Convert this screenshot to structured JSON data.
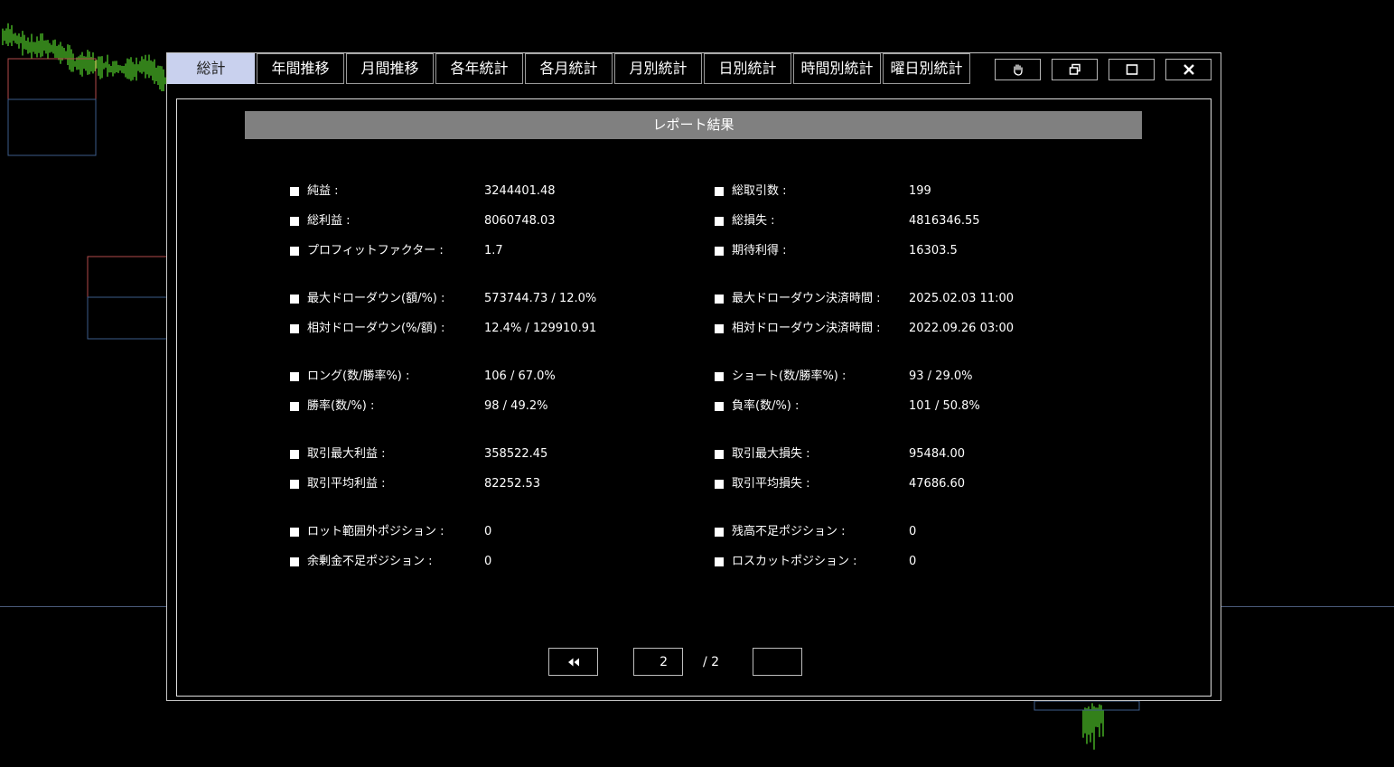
{
  "tabs": [
    "総計",
    "年間推移",
    "月間推移",
    "各年統計",
    "各月統計",
    "月別統計",
    "日別統計",
    "時間別統計",
    "曜日別統計"
  ],
  "window_buttons": [
    {
      "name": "hand-icon"
    },
    {
      "name": "restore-icon"
    },
    {
      "name": "maximize-icon"
    },
    {
      "name": "close-icon"
    }
  ],
  "report": {
    "title": "レポート結果",
    "left": [
      {
        "label": "純益 :",
        "value": "3244401.48"
      },
      {
        "label": "総利益 :",
        "value": "8060748.03"
      },
      {
        "label": "プロフィットファクター :",
        "value": "1.7"
      },
      {
        "label": "最大ドローダウン(額/%) :",
        "value": "573744.73 / 12.0%"
      },
      {
        "label": "相対ドローダウン(%/額) :",
        "value": "12.4% / 129910.91"
      },
      {
        "label": "ロング(数/勝率%) :",
        "value": "106 / 67.0%"
      },
      {
        "label": "勝率(数/%) :",
        "value": "98 / 49.2%"
      },
      {
        "label": "取引最大利益 :",
        "value": "358522.45"
      },
      {
        "label": "取引平均利益 :",
        "value": "82252.53"
      },
      {
        "label": "ロット範囲外ポジション :",
        "value": "0"
      },
      {
        "label": "余剰金不足ポジション :",
        "value": "0"
      }
    ],
    "right": [
      {
        "label": "総取引数 :",
        "value": "199"
      },
      {
        "label": "総損失 :",
        "value": "4816346.55"
      },
      {
        "label": "期待利得 :",
        "value": "16303.5"
      },
      {
        "label": "最大ドローダウン決済時間 :",
        "value": "2025.02.03 11:00"
      },
      {
        "label": "相対ドローダウン決済時間 :",
        "value": "2022.09.26 03:00"
      },
      {
        "label": "ショート(数/勝率%) :",
        "value": "93 / 29.0%"
      },
      {
        "label": "負率(数/%) :",
        "value": "101 / 50.8%"
      },
      {
        "label": "取引最大損失 :",
        "value": "95484.00"
      },
      {
        "label": "取引平均損失 :",
        "value": "47686.60"
      },
      {
        "label": "残高不足ポジション :",
        "value": "0"
      },
      {
        "label": "ロスカットポジション :",
        "value": "0"
      }
    ]
  },
  "pager": {
    "prev_icon": "double-chevron-left-icon",
    "current_page": "2",
    "total": "/ 2",
    "next_label": ""
  },
  "colors": {
    "active_tab": "#c9d1ee",
    "title_bar": "#808080",
    "candles": "#66ff33"
  }
}
